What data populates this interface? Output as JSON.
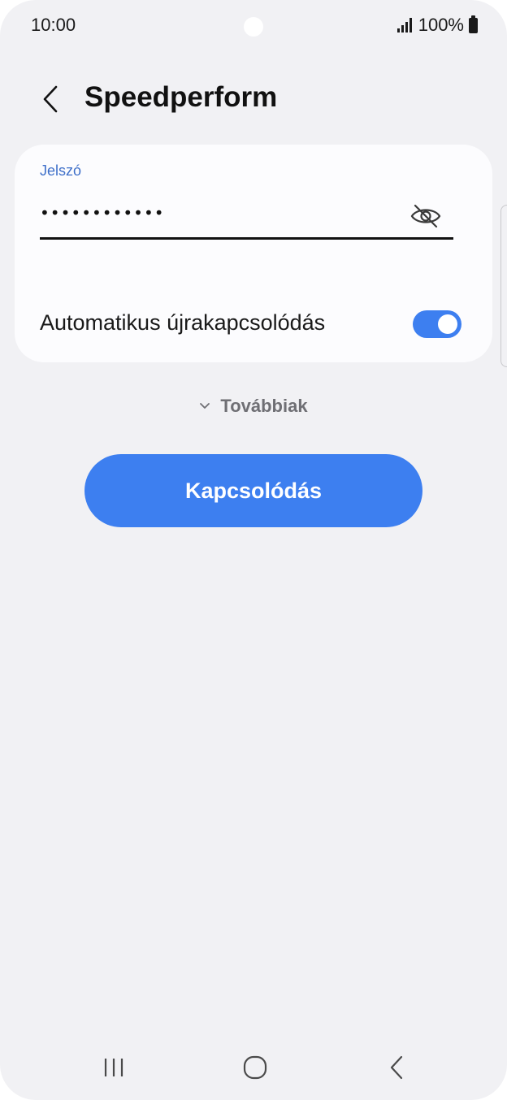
{
  "status_bar": {
    "time": "10:00",
    "battery_text": "100%",
    "icons": [
      "camera-dot",
      "signal-icon",
      "battery-icon"
    ]
  },
  "header": {
    "title": "Speedperform",
    "back_icon": "chevron-left-icon"
  },
  "password_field": {
    "label": "Jelszó",
    "value": "••••••••••••",
    "visibility_icon": "eye-off-icon"
  },
  "auto_reconnect": {
    "label": "Automatikus újrakapcsolódás",
    "enabled": true
  },
  "more": {
    "label": "Továbbiak",
    "icon": "chevron-down-icon"
  },
  "connect_button": {
    "label": "Kapcsolódás"
  },
  "nav_bar": {
    "icons": [
      "recent-apps-icon",
      "home-icon",
      "back-icon"
    ]
  },
  "colors": {
    "accent": "#3d7ff0",
    "label_blue": "#3e6fc9",
    "background": "#f1f1f4",
    "card": "#fcfcfe"
  }
}
